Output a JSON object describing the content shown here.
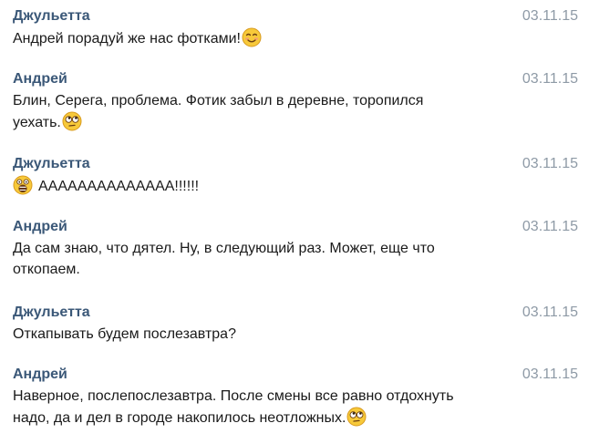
{
  "messages": [
    {
      "author": "Джульетта",
      "date": "03.11.15",
      "text": "Андрей порадуй же нас фотками!",
      "emoji": "smiling-face-icon",
      "emoji_position": "end"
    },
    {
      "author": "Андрей",
      "date": "03.11.15",
      "text": "Блин, Серега, проблема. Фотик забыл в деревне, торопился уехать.",
      "emoji": "rolling-eyes-face-icon",
      "emoji_position": "end"
    },
    {
      "author": "Джульетта",
      "date": "03.11.15",
      "text": "АААААААААААААА!!!!!!",
      "emoji": "screaming-face-icon",
      "emoji_position": "start"
    },
    {
      "author": "Андрей",
      "date": "03.11.15",
      "text": "Да сам знаю, что дятел. Ну, в следующий раз. Может, еще что откопаем.",
      "emoji": "",
      "emoji_position": "none"
    },
    {
      "author": "Джульетта",
      "date": "03.11.15",
      "text": "Откапывать будем послезавтра?",
      "emoji": "",
      "emoji_position": "none"
    },
    {
      "author": "Андрей",
      "date": "03.11.15",
      "text": "Наверное, послепослезавтра. После смены все равно отдохнуть надо, да и дел в городе накопилось неотложных.",
      "emoji": "rolling-eyes-face-icon",
      "emoji_position": "end"
    }
  ],
  "colors": {
    "author": "#3b5878",
    "date": "#8e9aa6",
    "text": "#1a1a1a",
    "background": "#ffffff"
  }
}
